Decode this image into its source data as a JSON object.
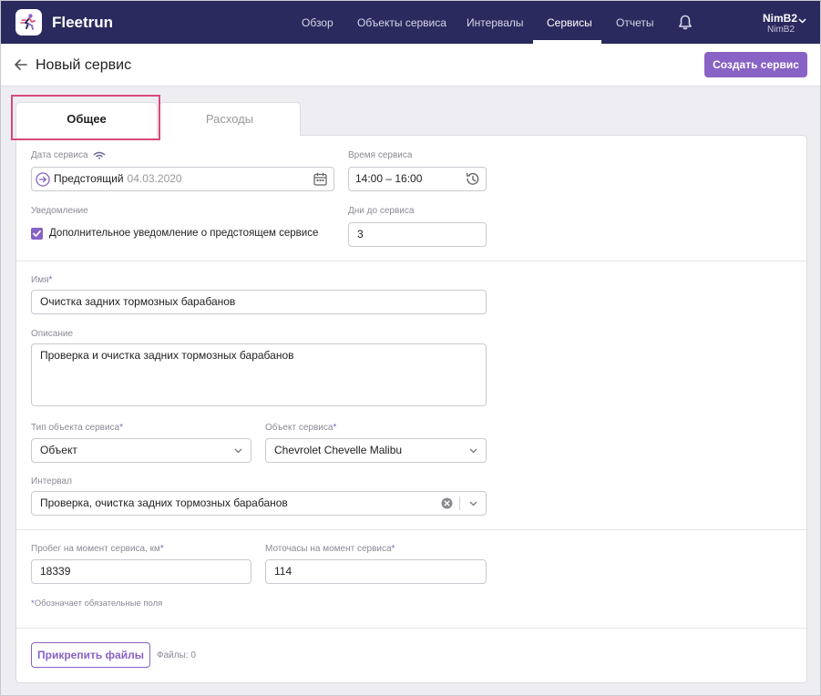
{
  "app": {
    "name": "Fleetrun",
    "brand_color": "#2b2a5e",
    "accent_color": "#8862c4"
  },
  "nav": {
    "items": [
      {
        "label": "Обзор",
        "active": false
      },
      {
        "label": "Объекты сервиса",
        "active": false
      },
      {
        "label": "Интервалы",
        "active": false
      },
      {
        "label": "Сервисы",
        "active": true
      },
      {
        "label": "Отчеты",
        "active": false
      }
    ],
    "notifications_icon": "bell-icon"
  },
  "user": {
    "name": "NimB2",
    "account": "NimB2"
  },
  "header": {
    "title": "Новый сервис",
    "create_button": "Создать сервис"
  },
  "tabs": [
    {
      "label": "Общее",
      "active": true
    },
    {
      "label": "Расходы",
      "active": false
    }
  ],
  "form": {
    "service_date": {
      "label": "Дата сервиса",
      "status": "Предстоящий",
      "date": "04.03.2020"
    },
    "service_time": {
      "label": "Время сервиса",
      "value": "14:00 – 16:00"
    },
    "notification": {
      "label": "Уведомление",
      "checkbox_label": "Дополнительное уведомление о предстоящем сервисе",
      "checked": true
    },
    "days_before": {
      "label": "Дни до сервиса",
      "value": "3"
    },
    "name": {
      "label": "Имя",
      "required": "*",
      "value": "Очистка задних тормозных барабанов"
    },
    "description": {
      "label": "Описание",
      "value": "Проверка и очистка задних тормозных барабанов"
    },
    "object_type": {
      "label": "Тип объекта сервиса",
      "required": "*",
      "value": "Объект"
    },
    "service_object": {
      "label": "Объект сервиса",
      "required": "*",
      "value": "Chevrolet Chevelle Malibu"
    },
    "interval": {
      "label": "Интервал",
      "value": "Проверка, очистка задних тормозных барабанов"
    },
    "mileage": {
      "label": "Пробег на момент сервиса, км",
      "required": "*",
      "value": "18339"
    },
    "engine_hours": {
      "label": "Моточасы на момент сервиса",
      "required": "*",
      "value": "114"
    },
    "required_note": {
      "mark": "*",
      "text": "Обозначает обязательные поля"
    },
    "attach_button": "Прикрепить файлы",
    "files_count": "Файлы: 0"
  }
}
